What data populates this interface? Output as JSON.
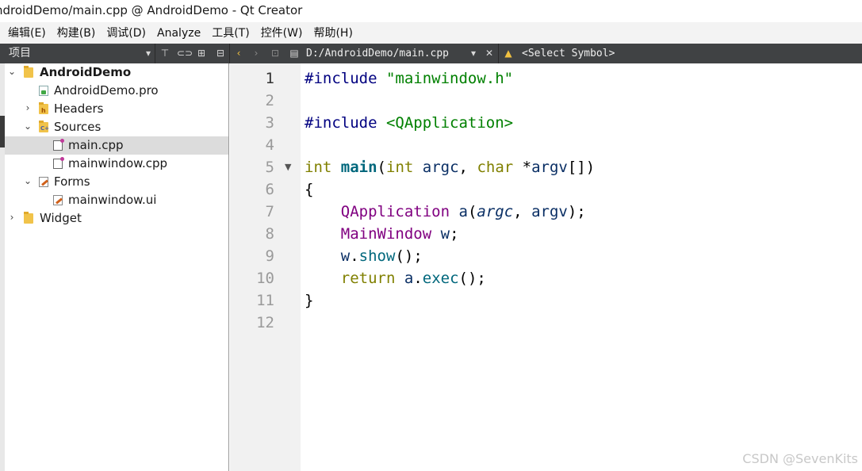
{
  "window": {
    "title": "ndroidDemo/main.cpp @ AndroidDemo - Qt Creator"
  },
  "menu": [
    "编辑(E)",
    "构建(B)",
    "调试(D)",
    "Analyze",
    "工具(T)",
    "控件(W)",
    "帮助(H)"
  ],
  "toolbar": {
    "panel_label": "项目",
    "file_path": "D:/AndroidDemo/main.cpp",
    "symbol": "<Select Symbol>"
  },
  "tree": [
    {
      "label": "AndroidDemo",
      "bold": true
    },
    {
      "label": "AndroidDemo.pro"
    },
    {
      "label": "Headers"
    },
    {
      "label": "Sources"
    },
    {
      "label": "main.cpp",
      "selected": true
    },
    {
      "label": "mainwindow.cpp"
    },
    {
      "label": "Forms"
    },
    {
      "label": "mainwindow.ui"
    },
    {
      "label": "Widget"
    }
  ],
  "editor": {
    "current_line": 1,
    "line_numbers": [
      "1",
      "2",
      "3",
      "4",
      "5",
      "6",
      "7",
      "8",
      "9",
      "10",
      "11",
      "12"
    ],
    "lines": [
      [
        {
          "t": "#include ",
          "c": "pp"
        },
        {
          "t": "\"mainwindow.h\"",
          "c": "str"
        }
      ],
      [],
      [
        {
          "t": "#include ",
          "c": "pp"
        },
        {
          "t": "<QApplication>",
          "c": "str"
        }
      ],
      [],
      [
        {
          "t": "int",
          "c": "kw"
        },
        {
          "t": " ",
          "c": ""
        },
        {
          "t": "main",
          "c": "fnb"
        },
        {
          "t": "(",
          "c": ""
        },
        {
          "t": "int",
          "c": "kw"
        },
        {
          "t": " ",
          "c": ""
        },
        {
          "t": "argc",
          "c": "lv"
        },
        {
          "t": ", ",
          "c": ""
        },
        {
          "t": "char",
          "c": "kw"
        },
        {
          "t": " *",
          "c": ""
        },
        {
          "t": "argv",
          "c": "lv"
        },
        {
          "t": "[])",
          "c": ""
        }
      ],
      [
        {
          "t": "{",
          "c": ""
        }
      ],
      [
        {
          "t": "    ",
          "c": ""
        },
        {
          "t": "QApplication",
          "c": "ty"
        },
        {
          "t": " ",
          "c": ""
        },
        {
          "t": "a",
          "c": "lv"
        },
        {
          "t": "(",
          "c": ""
        },
        {
          "t": "argc",
          "c": "it"
        },
        {
          "t": ", ",
          "c": ""
        },
        {
          "t": "argv",
          "c": "lv"
        },
        {
          "t": ");",
          "c": ""
        }
      ],
      [
        {
          "t": "    ",
          "c": ""
        },
        {
          "t": "MainWindow",
          "c": "ty"
        },
        {
          "t": " ",
          "c": ""
        },
        {
          "t": "w",
          "c": "lv"
        },
        {
          "t": ";",
          "c": ""
        }
      ],
      [
        {
          "t": "    ",
          "c": ""
        },
        {
          "t": "w",
          "c": "lv"
        },
        {
          "t": ".",
          "c": ""
        },
        {
          "t": "show",
          "c": "fn"
        },
        {
          "t": "();",
          "c": ""
        }
      ],
      [
        {
          "t": "    ",
          "c": ""
        },
        {
          "t": "return",
          "c": "kw"
        },
        {
          "t": " ",
          "c": ""
        },
        {
          "t": "a",
          "c": "lv"
        },
        {
          "t": ".",
          "c": ""
        },
        {
          "t": "exec",
          "c": "fn"
        },
        {
          "t": "();",
          "c": ""
        }
      ],
      [
        {
          "t": "}",
          "c": ""
        }
      ],
      []
    ]
  },
  "watermark": "CSDN @SevenKits"
}
